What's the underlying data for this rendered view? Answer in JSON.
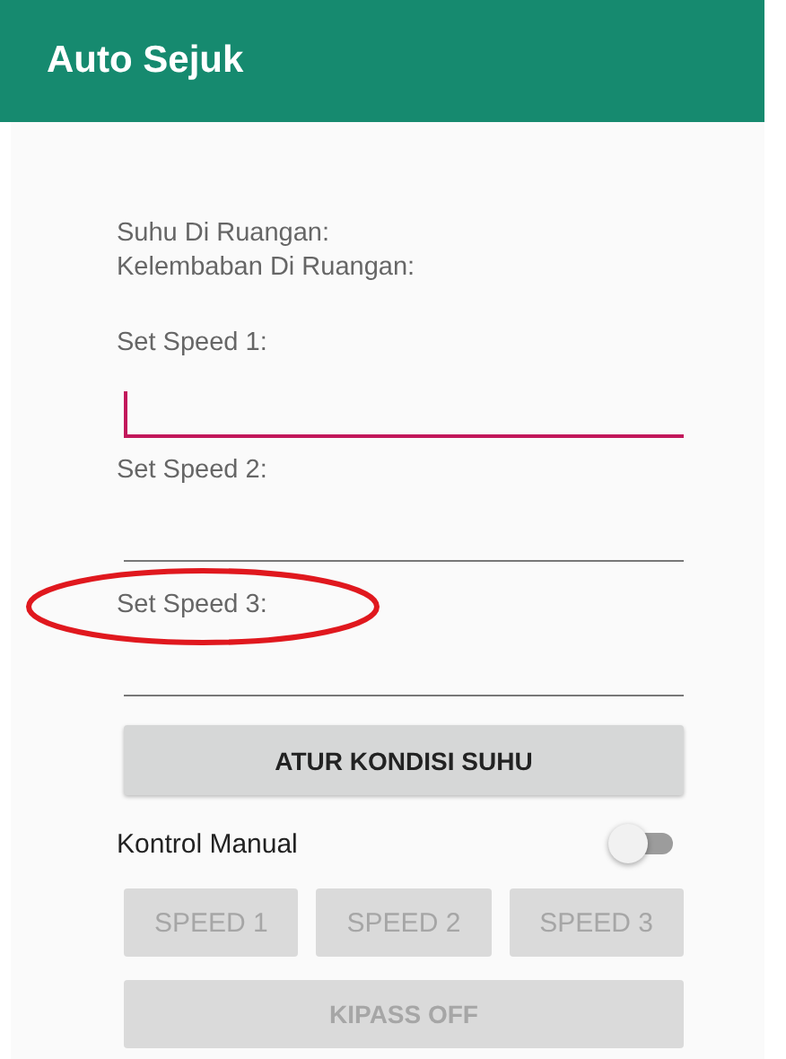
{
  "app_bar": {
    "title": "Auto Sejuk"
  },
  "readings": [
    "Suhu Di Ruangan:",
    "Kelembaban Di Ruangan:"
  ],
  "speed_fields": [
    {
      "label": "Set Speed 1:",
      "focused": true,
      "highlighted": false
    },
    {
      "label": "Set Speed 2:",
      "focused": false,
      "highlighted": false
    },
    {
      "label": "Set Speed 3:",
      "focused": false,
      "highlighted": true
    }
  ],
  "apply_button": {
    "label": "ATUR KONDISI SUHU",
    "disabled": false
  },
  "manual_switch": {
    "label": "Kontrol Manual",
    "on": false
  },
  "speed_buttons": [
    {
      "label": "SPEED 1",
      "disabled": true
    },
    {
      "label": "SPEED 2",
      "disabled": true
    },
    {
      "label": "SPEED 3",
      "disabled": true
    }
  ],
  "off_button": {
    "label": "KIPASS OFF",
    "disabled": true
  }
}
